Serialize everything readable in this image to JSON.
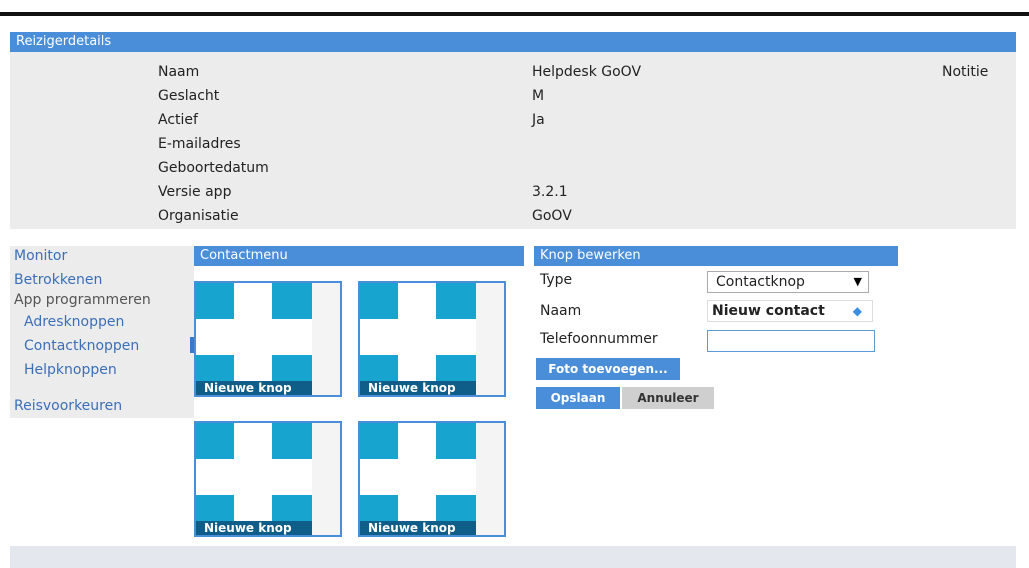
{
  "reiziger": {
    "header": "Reizigerdetails",
    "notitie": "Notitie",
    "rows": [
      {
        "label": "Naam",
        "value": "Helpdesk GoOV"
      },
      {
        "label": "Geslacht",
        "value": "M"
      },
      {
        "label": "Actief",
        "value": "Ja"
      },
      {
        "label": "E-mailadres",
        "value": ""
      },
      {
        "label": "Geboortedatum",
        "value": ""
      },
      {
        "label": "Versie app",
        "value": "3.2.1"
      },
      {
        "label": "Organisatie",
        "value": "GoOV"
      }
    ]
  },
  "nav": {
    "monitor": "Monitor",
    "betrokkenen": "Betrokkenen",
    "app_programmeren": "App programmeren",
    "adresknoppen": "Adresknoppen",
    "contactknoppen": "Contactknoppen",
    "helpknoppen": "Helpknoppen",
    "reisvoorkeuren": "Reisvoorkeuren"
  },
  "contactmenu": {
    "header": "Contactmenu",
    "tiles": [
      {
        "label": "Nieuwe knop",
        "icon": "plus-cross-icon"
      },
      {
        "label": "Nieuwe knop",
        "icon": "plus-cross-icon"
      },
      {
        "label": "Nieuwe knop",
        "icon": "plus-cross-icon"
      },
      {
        "label": "Nieuwe knop",
        "icon": "plus-cross-icon"
      }
    ]
  },
  "knop_bewerken": {
    "header": "Knop bewerken",
    "type_label": "Type",
    "type_value": "Contactknop",
    "naam_label": "Naam",
    "naam_value": "Nieuw contact",
    "telefoon_label": "Telefoonnummer",
    "telefoon_value": "",
    "foto_button": "Foto toevoegen...",
    "opslaan_button": "Opslaan",
    "annuleer_button": "Annuleer"
  },
  "colors": {
    "header_blue": "#4a8ed9",
    "tile_blue": "#17a5cf",
    "tile_label_bg": "#0f5e8a",
    "panel_gray": "#ececec"
  }
}
